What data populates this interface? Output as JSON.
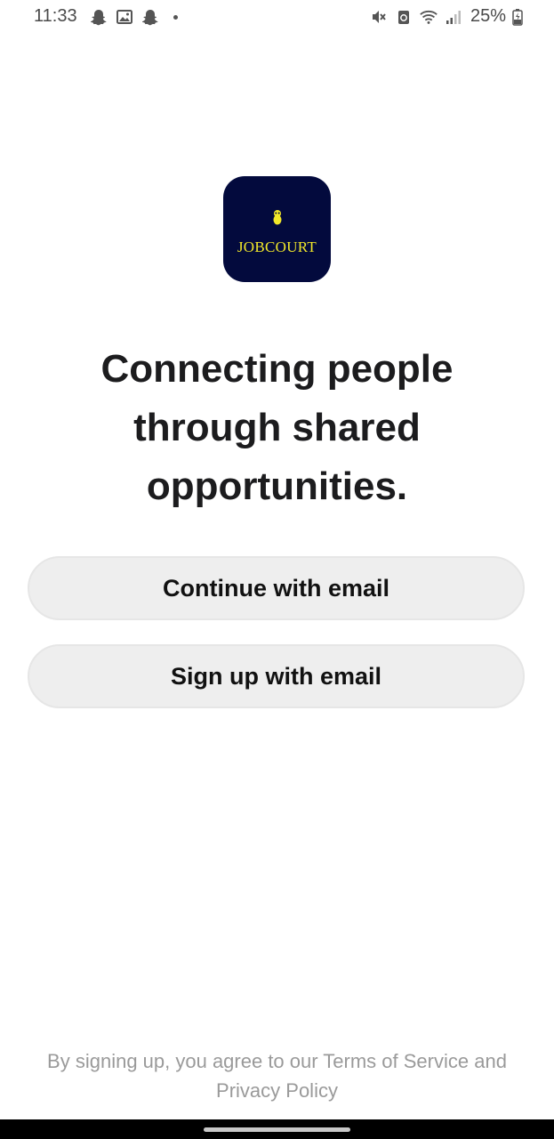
{
  "status_bar": {
    "time": "11:33",
    "battery_percent": "25%",
    "left_icons": [
      "snapchat-icon",
      "gallery-icon",
      "snapchat-icon",
      "dot-icon"
    ],
    "right_icons": [
      "mute-icon",
      "data-saver-icon",
      "wifi-icon",
      "signal-icon",
      "battery-charging-icon"
    ]
  },
  "logo": {
    "text": "JOBCOURT",
    "background": "#030a3d",
    "accent": "#f2e829"
  },
  "headline": {
    "line1": "Connecting people",
    "line2": "through shared",
    "line3": "opportunities."
  },
  "buttons": {
    "continue_label": "Continue with email",
    "signup_label": "Sign up with email"
  },
  "legal": {
    "prefix": "By signing up, you agree to our ",
    "terms": "Terms of Service",
    "and": " and",
    "privacy": "Privacy Policy"
  }
}
